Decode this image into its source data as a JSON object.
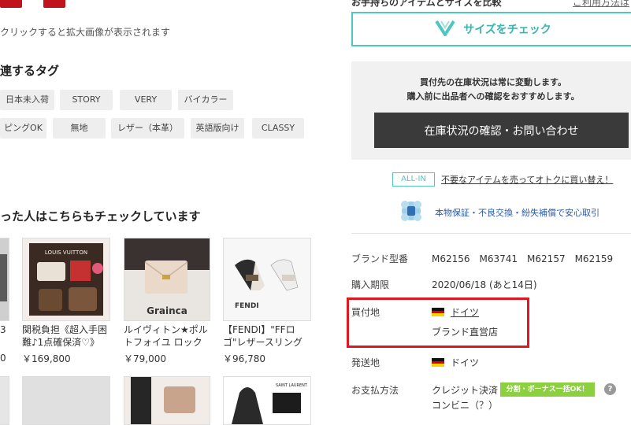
{
  "left": {
    "image_hint": "クリックすると拡大画像が表示されます",
    "tags_title": "連するタグ",
    "tags_row1": [
      "日本未入荷",
      "STORY",
      "VERY",
      "バイカラー"
    ],
    "tags_row2": [
      "ピングOK",
      "無地",
      "レザー（本革）",
      "英語版向け",
      "CLASSY"
    ],
    "also_title": "った人はこちらもチェックしています",
    "products": [
      {
        "title_l1": "関税負担《超入手困",
        "title_l2": "難♪1点確保済♡》",
        "price": "￥169,800",
        "img_label": "LOUIS VUITTON"
      },
      {
        "title_l1": "ルイヴィトン★ポル",
        "title_l2": "トフォイユ ロック",
        "price": "￥79,000",
        "img_label": "Grainca"
      },
      {
        "title_l1": "【FENDI】\"FFロ",
        "title_l2": "ゴ\"レザースリング",
        "price": "￥96,780",
        "img_label": "FENDI"
      }
    ],
    "partial_prices": [
      "3",
      "0"
    ],
    "bottom_img_label": "SAINT LAURENT"
  },
  "right": {
    "top_text": "お手持ちのアイテムとサイズを比較",
    "top_link": "ご利用方法は",
    "size_check_label": "サイズをチェック",
    "stock_line1": "買付先の在庫状況は常に変動します。",
    "stock_line2": "購入前に出品者への確認をおすすめします。",
    "contact_button": "在庫状況の確認・お問い合わせ",
    "allin_badge": "ALL-IN",
    "allin_link": "不要なアイテムを売ってオトクに買い替え！",
    "guarantee": "本物保証・不良交換・紛失補償で安心取引",
    "details": {
      "brand_no_label": "ブランド型番",
      "brand_no_value": "M62156　M63741　M62157　M62159",
      "deadline_label": "購入期限",
      "deadline_value": "2020/06/18 (あと14日)",
      "buy_place_label": "買付地",
      "buy_place_value": "ドイツ",
      "buy_place_sub": "ブランド直営店",
      "ship_label": "発送地",
      "ship_value": "ドイツ",
      "payment_label": "お支払方法",
      "payment_value1": "クレジット決済",
      "payment_value2": "コンビニ（？）",
      "payment_badge": "分割・ボーナス一括OK！",
      "help": "?"
    }
  },
  "colors": {
    "accent": "#4ec7c0",
    "highlight": "#e2161e",
    "button_dark": "#3a3a3a",
    "badge_green": "#8ccf3f"
  }
}
